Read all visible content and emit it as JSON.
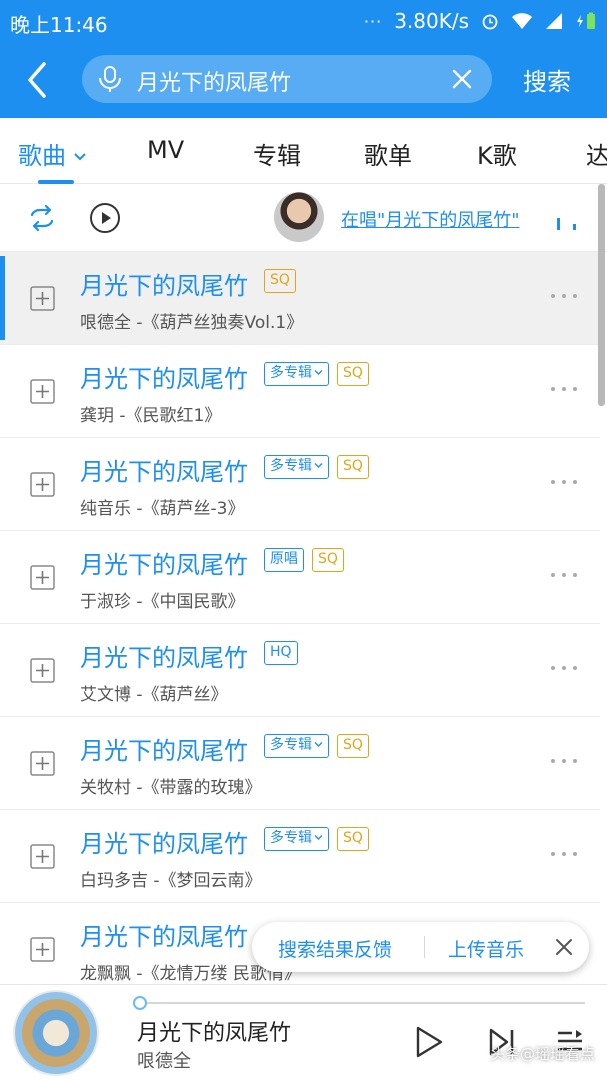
{
  "status_bar": {
    "time": "晚上11:46",
    "dots": "···",
    "speed": "3.80K/s"
  },
  "header": {
    "query": "月光下的凤尾竹",
    "search_button": "搜索"
  },
  "tabs": [
    {
      "label": "歌曲",
      "active": true
    },
    {
      "label": "MV",
      "active": false
    },
    {
      "label": "专辑",
      "active": false
    },
    {
      "label": "歌单",
      "active": false
    },
    {
      "label": "K歌",
      "active": false
    },
    {
      "label": "达",
      "active": false
    }
  ],
  "action_row": {
    "singing_link": "在唱\"月光下的凤尾竹\""
  },
  "songs": [
    {
      "title": "月光下的凤尾竹",
      "badges": [
        "SQ"
      ],
      "subtitle": "哏德全 -《葫芦丝独奏Vol.1》",
      "playing": true
    },
    {
      "title": "月光下的凤尾竹",
      "badges": [
        "多专辑",
        "SQ"
      ],
      "subtitle": "龚玥 -《民歌红1》",
      "playing": false
    },
    {
      "title": "月光下的凤尾竹",
      "badges": [
        "多专辑",
        "SQ"
      ],
      "subtitle": "纯音乐 -《葫芦丝-3》",
      "playing": false
    },
    {
      "title": "月光下的凤尾竹",
      "badges": [
        "原唱",
        "SQ"
      ],
      "subtitle": "于淑珍 -《中国民歌》",
      "playing": false
    },
    {
      "title": "月光下的凤尾竹",
      "badges": [
        "HQ"
      ],
      "subtitle": "艾文博 -《葫芦丝》",
      "playing": false
    },
    {
      "title": "月光下的凤尾竹",
      "badges": [
        "多专辑",
        "SQ"
      ],
      "subtitle": "关牧村 -《带露的玫瑰》",
      "playing": false
    },
    {
      "title": "月光下的凤尾竹",
      "badges": [
        "多专辑",
        "SQ"
      ],
      "subtitle": "白玛多吉 -《梦回云南》",
      "playing": false
    },
    {
      "title": "月光下的凤尾竹",
      "badges": [],
      "subtitle": "龙飘飘 -《龙情万缕 民歌情》",
      "playing": false
    }
  ],
  "feedback": {
    "left": "搜索结果反馈",
    "right": "上传音乐"
  },
  "player": {
    "title": "月光下的凤尾竹",
    "artist": "哏德全",
    "progress": 0
  },
  "watermark": "头条@瑶瑶看点",
  "colors": {
    "accent": "#1d8ff0",
    "sq_badge": "#e2a41a"
  }
}
